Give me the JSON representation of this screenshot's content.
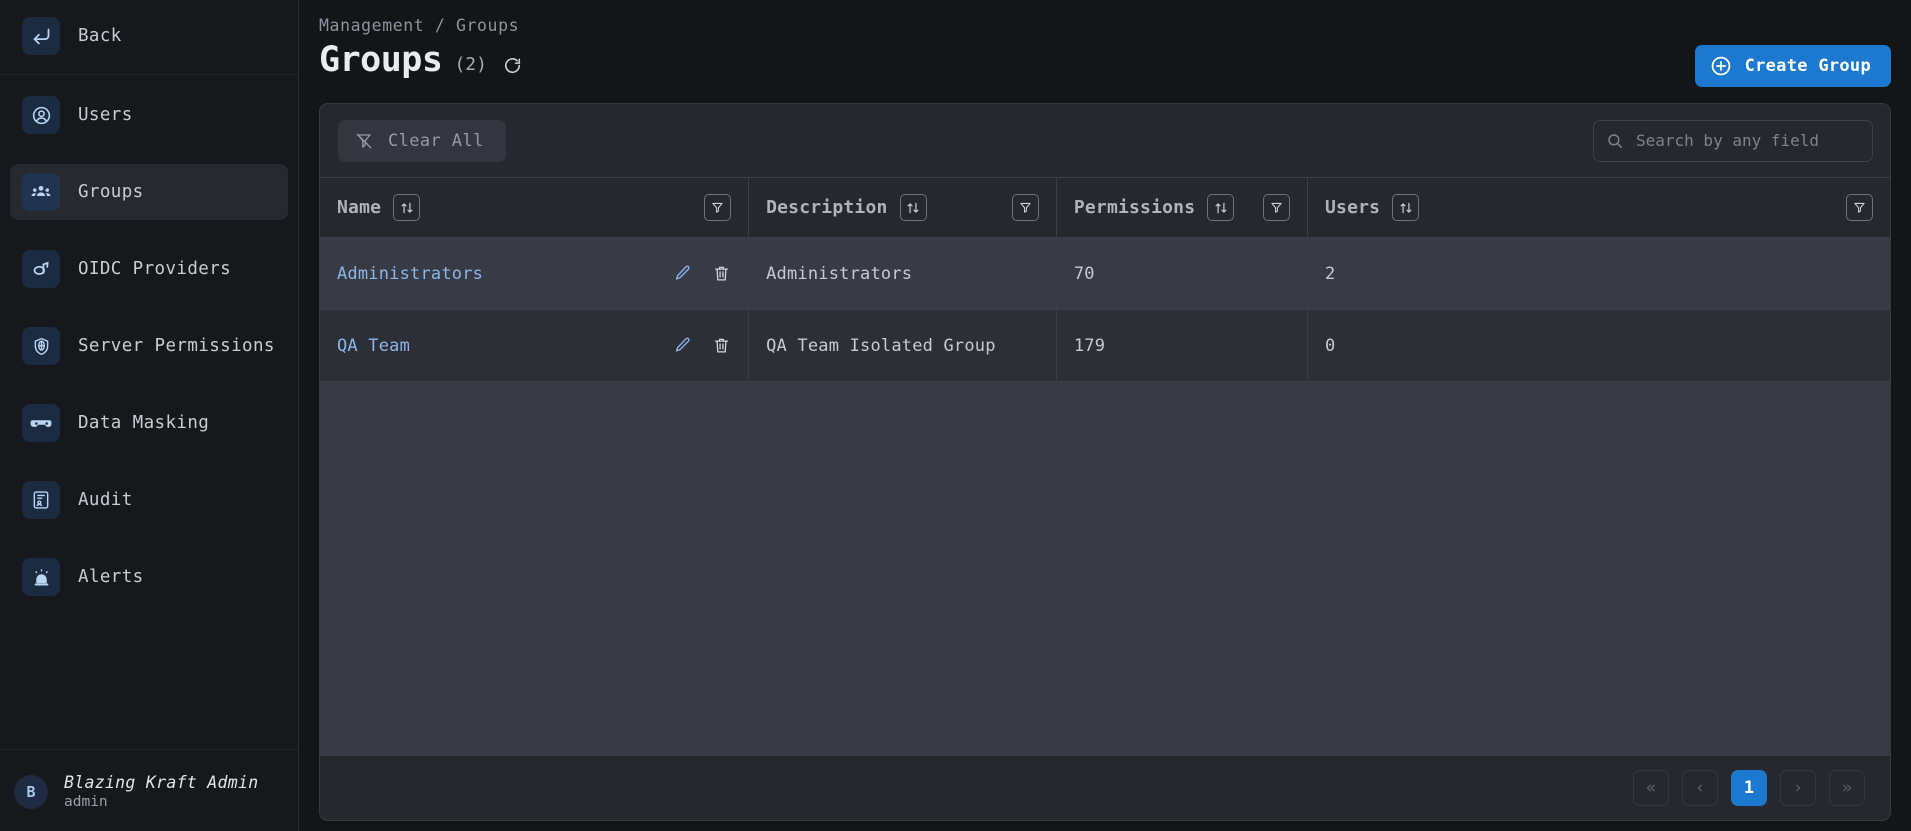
{
  "sidebar": {
    "back": {
      "label": "Back",
      "icon": "back-arrow-icon"
    },
    "items": [
      {
        "label": "Users",
        "icon": "user-circle-icon",
        "active": false
      },
      {
        "label": "Groups",
        "icon": "groups-icon",
        "active": true
      },
      {
        "label": "OIDC Providers",
        "icon": "oidc-icon",
        "active": false
      },
      {
        "label": "Server Permissions",
        "icon": "shield-globe-icon",
        "active": false
      },
      {
        "label": "Data Masking",
        "icon": "mask-icon",
        "active": false
      },
      {
        "label": "Audit",
        "icon": "audit-document-icon",
        "active": false
      },
      {
        "label": "Alerts",
        "icon": "alert-siren-icon",
        "active": false
      }
    ],
    "user": {
      "initial": "B",
      "name": "Blazing Kraft Admin",
      "username": "admin"
    }
  },
  "header": {
    "breadcrumb": "Management / Groups",
    "title": "Groups",
    "count": "(2)",
    "refresh_icon": "refresh-icon",
    "create_button": {
      "label": "Create Group",
      "icon": "plus-circle-icon"
    }
  },
  "toolbar": {
    "clear_all": {
      "label": "Clear All",
      "icon": "filter-off-icon"
    },
    "search": {
      "placeholder": "Search by any field",
      "value": "",
      "icon": "search-icon"
    }
  },
  "table": {
    "columns": [
      {
        "label": "Name",
        "sort_icon": "sort-icon",
        "filter_icon": "filter-icon"
      },
      {
        "label": "Description",
        "sort_icon": "sort-icon",
        "filter_icon": "filter-icon"
      },
      {
        "label": "Permissions",
        "sort_icon": "sort-icon",
        "filter_icon": "filter-icon"
      },
      {
        "label": "Users",
        "sort_icon": "sort-icon",
        "filter_icon": "filter-icon"
      }
    ],
    "rows": [
      {
        "name": "Administrators",
        "description": "Administrators",
        "permissions": "70",
        "users": "2"
      },
      {
        "name": "QA Team",
        "description": "QA Team Isolated Group",
        "permissions": "179",
        "users": "0"
      }
    ],
    "row_actions": {
      "edit_icon": "pencil-icon",
      "delete_icon": "trash-icon"
    }
  },
  "pagination": {
    "first": "«",
    "prev": "‹",
    "pages": [
      "1"
    ],
    "current": "1",
    "next": "›",
    "last": "»"
  },
  "colors": {
    "accent": "#1c79cf",
    "page_bg": "#141517",
    "card_bg": "#26282e",
    "row_odd": "#383b46",
    "row_even": "#2c2f36",
    "link": "#8ab6e8"
  }
}
